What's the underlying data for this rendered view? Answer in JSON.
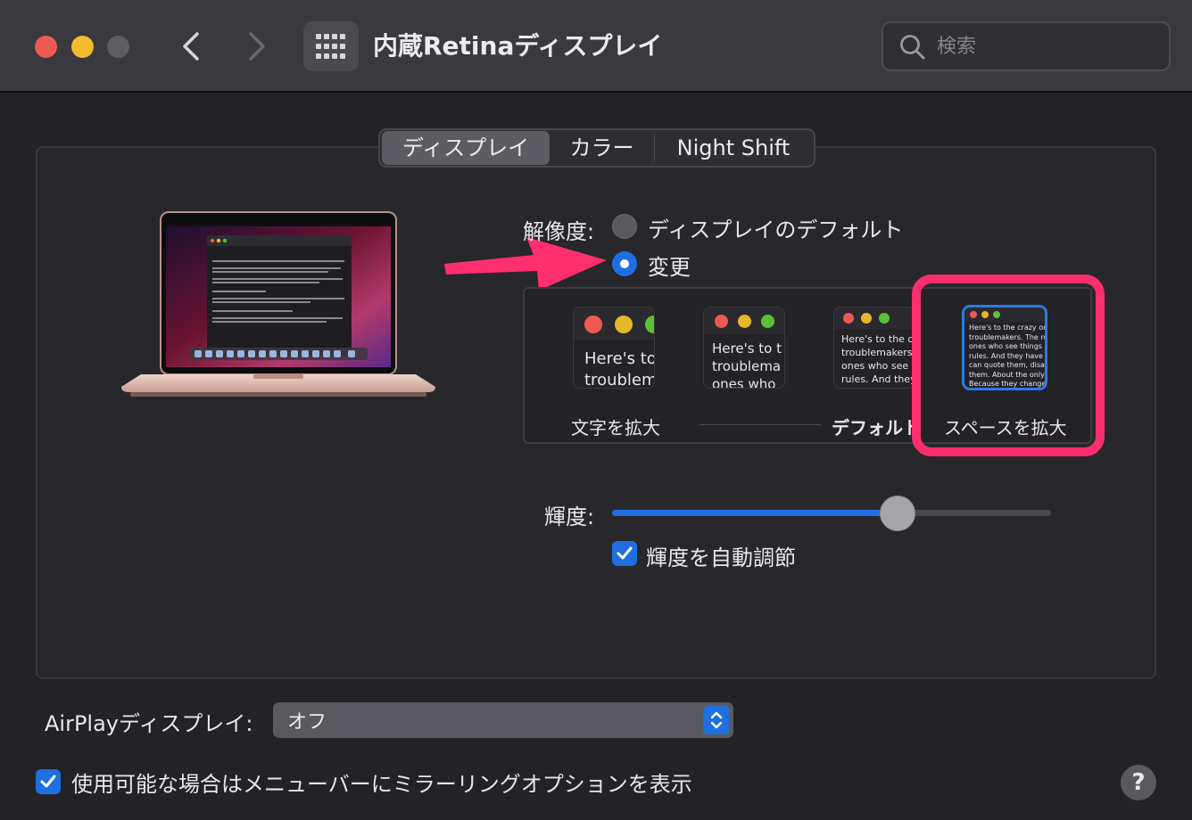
{
  "window": {
    "title": "内蔵Retinaディスプレイ"
  },
  "search": {
    "placeholder": "検索"
  },
  "tabs": [
    {
      "label": "ディスプレイ",
      "active": true
    },
    {
      "label": "カラー",
      "active": false
    },
    {
      "label": "Night Shift",
      "active": false
    }
  ],
  "resolution": {
    "label": "解像度:",
    "options": [
      {
        "label": "ディスプレイのデフォルト",
        "selected": false
      },
      {
        "label": "変更",
        "selected": true
      }
    ],
    "scaled": {
      "left_caption": "文字を拡大",
      "default_caption": "デフォルト",
      "right_caption": "スペースを拡大",
      "selected": "スペースを拡大",
      "previews": [
        {
          "text": "Here's to\ntroublem"
        },
        {
          "text": "Here's to t\ntroublema\nones who"
        },
        {
          "text": "Here's to the c\ntroublemakers\nones who see t\nrules. And they"
        },
        {
          "text": "Here's to the crazy one\ntroublemakers. The rou\nones who see things dif\nrules. And they have no\ncan quote them, disagre\nthem. About the only th\nBecause they change th"
        }
      ]
    }
  },
  "brightness": {
    "label": "輝度:",
    "value": 0.65,
    "auto_label": "輝度を自動調節",
    "auto_checked": true
  },
  "airplay": {
    "label": "AirPlayディスプレイ:",
    "value": "オフ"
  },
  "mirror": {
    "label": "使用可能な場合はメニューバーにミラーリングオプションを表示",
    "checked": true
  },
  "help": {
    "label": "?"
  },
  "colors": {
    "accent": "#1f6fe0",
    "highlight": "#ff2f6e",
    "close": "#ee5a52",
    "minimize": "#f4bb2f"
  }
}
